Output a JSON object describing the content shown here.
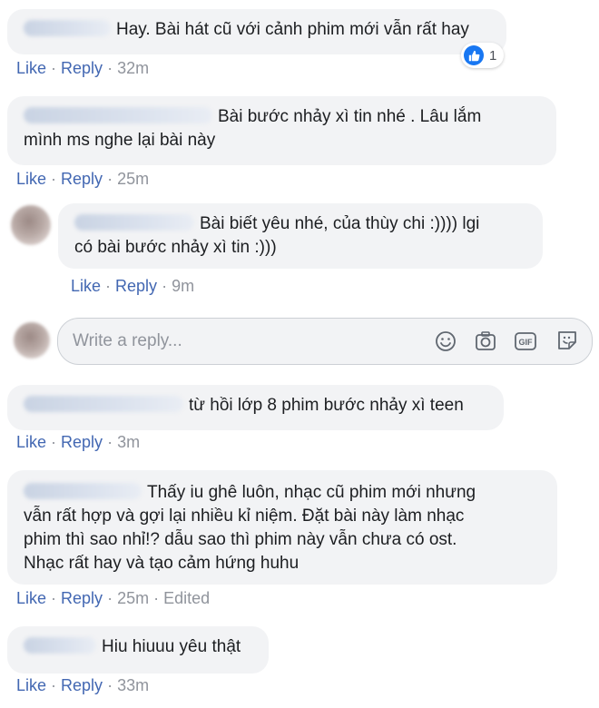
{
  "comments": [
    {
      "text": "Hay. Bài hát cũ với cảnh phim mới vẫn rất hay",
      "like": "Like",
      "reply": "Reply",
      "time": "32m",
      "reaction_count": "1"
    },
    {
      "text": "Bài bước nhảy xì tin nhé . Lâu lắm mình ms nghe lại bài này",
      "line1": "Bài bước nhảy xì tin nhé . Lâu lắm",
      "line2": "mình ms nghe lại bài này",
      "like": "Like",
      "reply": "Reply",
      "time": "25m"
    },
    {
      "text": "Bài biết yêu nhé, của thùy chi :)))) lgi có bài bước nhảy xì tin :)))",
      "line1": "Bài biết yêu nhé, của thùy chi :)))) lgi",
      "line2": "có bài bước nhảy xì tin :)))",
      "like": "Like",
      "reply": "Reply",
      "time": "9m"
    },
    {
      "text": "từ hồi lớp 8 phim bước nhảy xì teen",
      "like": "Like",
      "reply": "Reply",
      "time": "3m"
    },
    {
      "line1": "Thấy iu ghê luôn, nhạc cũ phim mới nhưng",
      "line2": "vẫn rất hợp và gợi lại nhiều kỉ niệm. Đặt bài này làm nhạc",
      "line3": "phim thì sao nhỉ!? dẫu sao thì phim này vẫn chưa có ost.",
      "line4": "Nhạc rất hay và tạo cảm hứng huhu",
      "like": "Like",
      "reply": "Reply",
      "time": "25m",
      "edited": "Edited"
    },
    {
      "text": "Hiu hiuuu yêu thật",
      "like": "Like",
      "reply": "Reply",
      "time": "33m"
    }
  ],
  "reply_box": {
    "placeholder": "Write a reply...",
    "icons": [
      "smiley-icon",
      "camera-icon",
      "gif-icon",
      "sticker-icon"
    ]
  },
  "separator": "·",
  "colors": {
    "link": "#4267b2",
    "meta": "#90949c",
    "bubble": "#f2f3f5",
    "like_blue": "#1877f2"
  }
}
